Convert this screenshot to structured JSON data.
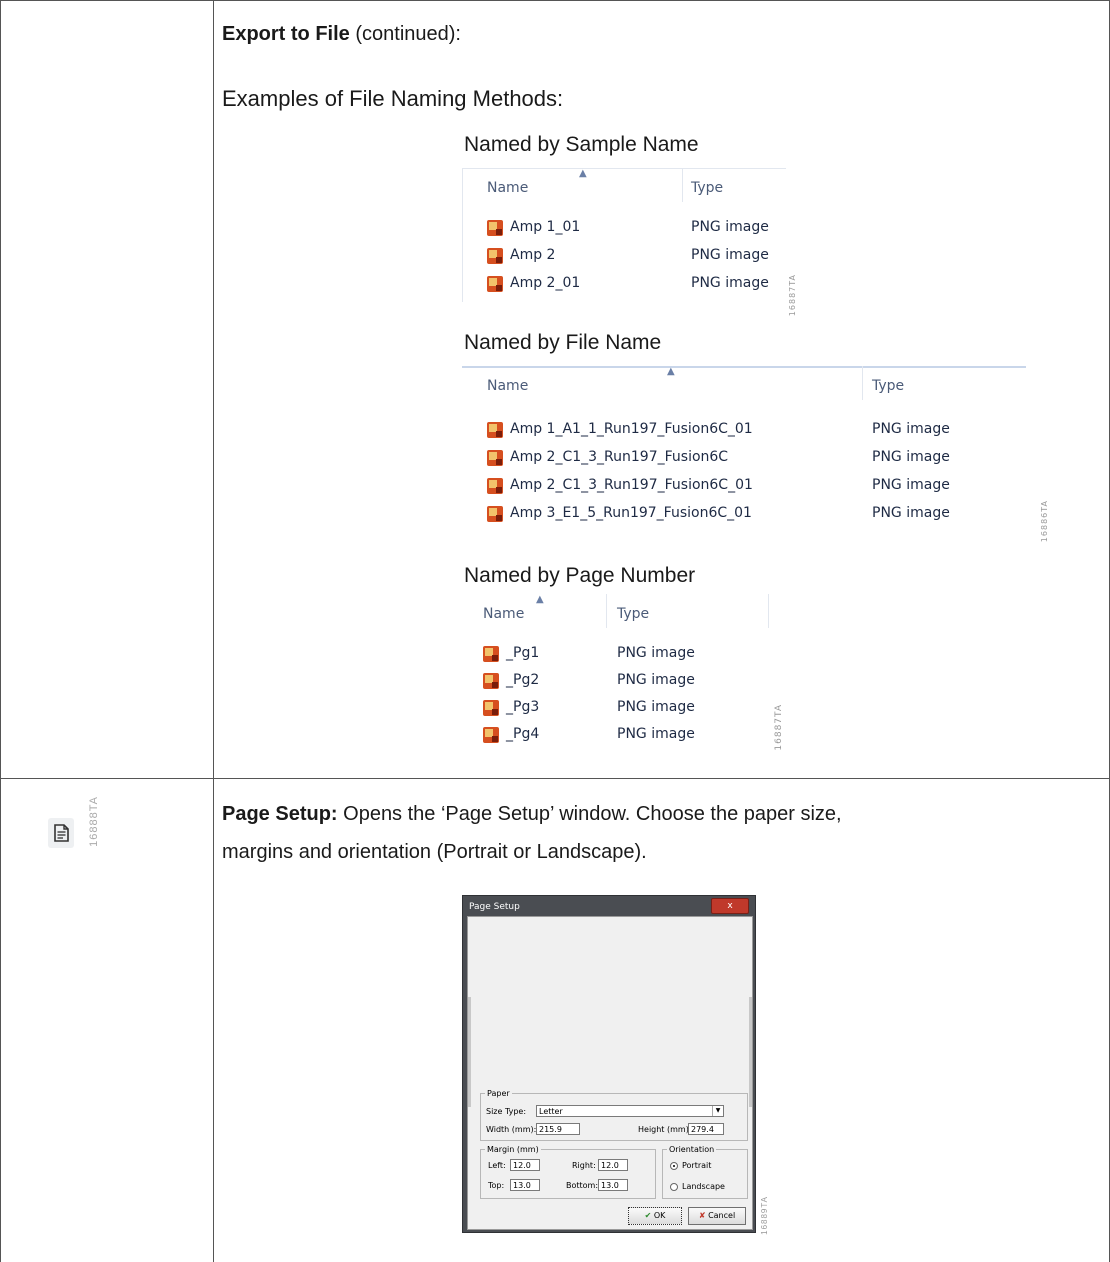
{
  "section1": {
    "title_bold": "Export to File",
    "title_rest": " (continued):",
    "examples_heading": "Examples of File Naming Methods:",
    "sample": {
      "heading": "Named by Sample Name",
      "col_name": "Name",
      "col_type": "Type",
      "rows": [
        {
          "name": "Amp 1_01",
          "type": "PNG image"
        },
        {
          "name": "Amp 2",
          "type": "PNG image"
        },
        {
          "name": "Amp 2_01",
          "type": "PNG image"
        }
      ],
      "fig_code": "16887TA"
    },
    "file": {
      "heading": "Named by File Name",
      "col_name": "Name",
      "col_type": "Type",
      "rows": [
        {
          "name": "Amp 1_A1_1_Run197_Fusion6C_01",
          "type": "PNG image"
        },
        {
          "name": "Amp 2_C1_3_Run197_Fusion6C",
          "type": "PNG image"
        },
        {
          "name": "Amp 2_C1_3_Run197_Fusion6C_01",
          "type": "PNG image"
        },
        {
          "name": "Amp 3_E1_5_Run197_Fusion6C_01",
          "type": "PNG image"
        }
      ],
      "fig_code": "16886TA"
    },
    "page": {
      "heading": "Named by Page Number",
      "col_name": "Name",
      "col_type": "Type",
      "rows": [
        {
          "name": "_Pg1",
          "type": "PNG image"
        },
        {
          "name": "_Pg2",
          "type": "PNG image"
        },
        {
          "name": "_Pg3",
          "type": "PNG image"
        },
        {
          "name": "_Pg4",
          "type": "PNG image"
        }
      ],
      "fig_code": "16887TA"
    }
  },
  "section2": {
    "icon": "page-setup-icon",
    "icon_fig_code": "16888TA",
    "title_bold": "Page Setup:",
    "desc_line1": " Opens the ‘Page Setup’ window. Choose the paper size,",
    "desc_line2": "margins and orientation (Portrait or Landscape).",
    "dialog": {
      "title": "Page Setup",
      "close": "x",
      "paper_legend": "Paper",
      "size_type_label": "Size Type:",
      "size_type_value": "Letter",
      "width_label": "Width (mm):",
      "width_value": "215.9",
      "height_label": "Height (mm):",
      "height_value": "279.4",
      "margin_legend": "Margin (mm)",
      "left_label": "Left:",
      "left_value": "12.0",
      "right_label": "Right:",
      "right_value": "12.0",
      "top_label": "Top:",
      "top_value": "13.0",
      "bottom_label": "Bottom:",
      "bottom_value": "13.0",
      "orientation_legend": "Orientation",
      "portrait_label": "Portrait",
      "landscape_label": "Landscape",
      "selected_orientation": "Portrait",
      "ok_label": "OK",
      "cancel_label": "Cancel"
    },
    "dialog_fig_code": "16889TA"
  }
}
